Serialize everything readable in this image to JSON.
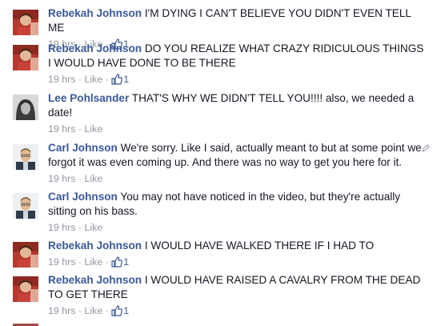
{
  "comments": [
    {
      "author": "Rebekah Johnson",
      "text": "I'M DYING I CAN'T BELIEVE YOU DIDN'T EVEN TELL ME",
      "time": "19 hrs",
      "like_label": "Like",
      "like_count": "1",
      "avatar_icon": "rebekah-avatar"
    },
    {
      "author": "Rebekah Johnson",
      "text": "DO YOU REALIZE WHAT CRAZY RIDICULOUS THINGS I WOULD HAVE DONE TO BE THERE",
      "time": "19 hrs",
      "like_label": "Like",
      "like_count": "1",
      "avatar_icon": "rebekah-avatar"
    },
    {
      "author": "Lee Pohlsander",
      "text": "THAT'S WHY WE DIDN'T TELL YOU!!!! also, we needed a date!",
      "time": "19 hrs",
      "like_label": "Like",
      "like_count": "",
      "avatar_icon": "lee-avatar"
    },
    {
      "author": "Carl Johnson",
      "text": "We're sorry. Like I said, actually meant to but at some point we forgot it was even coming up. And there was no way to get you here for it.",
      "time": "19 hrs",
      "like_label": "Like",
      "like_count": "",
      "avatar_icon": "carl-avatar",
      "edit_icon": "pencil-icon"
    },
    {
      "author": "Carl Johnson",
      "text": "You may not have noticed in the video, but they're actually sitting on his bass.",
      "time": "19 hrs",
      "like_label": "Like",
      "like_count": "",
      "avatar_icon": "carl-avatar"
    },
    {
      "author": "Rebekah Johnson",
      "text": "I WOULD HAVE WALKED THERE IF I HAD TO",
      "time": "19 hrs",
      "like_label": "Like",
      "like_count": "1",
      "avatar_icon": "rebekah-avatar"
    },
    {
      "author": "Rebekah Johnson",
      "text": "I WOULD HAVE RAISED A CAVALRY FROM THE DEAD TO GET THERE",
      "time": "19 hrs",
      "like_label": "Like",
      "like_count": "1",
      "avatar_icon": "rebekah-avatar"
    }
  ],
  "meta_separator": "·",
  "colors": {
    "author": "#3b5998",
    "text": "#141823",
    "meta": "#9197a3"
  },
  "like_icon": "thumbs-up-icon"
}
